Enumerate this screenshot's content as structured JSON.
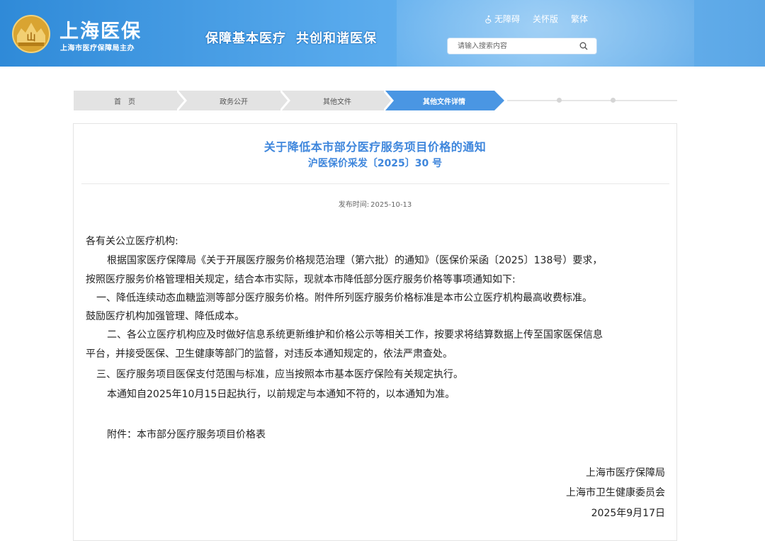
{
  "header": {
    "logo_title": "上海医保",
    "logo_subtitle": "上海市医疗保障局主办",
    "emblem_text": "山",
    "slogan_left": "保障基本医疗",
    "slogan_right": "共创和谐医保",
    "links": [
      {
        "icon": "accessibility-icon",
        "label": "无障碍"
      },
      {
        "label": "关怀版"
      },
      {
        "label": "繁体"
      }
    ],
    "search": {
      "placeholder": "请输入搜索内容",
      "icon": "search-icon"
    },
    "colors": {
      "gradient_start": "#2f8ad8",
      "gradient_end": "#6fb7f0"
    }
  },
  "breadcrumb": {
    "items": [
      {
        "label": "首　页"
      },
      {
        "label": "政务公开"
      },
      {
        "label": "其他文件"
      },
      {
        "label": "其他文件详情",
        "active": true
      }
    ],
    "colors": {
      "inactive": "#e3e3e3",
      "active": "#4a96e3"
    }
  },
  "article": {
    "title": "关于降低本市部分医疗服务项目价格的通知",
    "doc_number": "沪医保价采发〔2025〕30 号",
    "date_label": "发布时间:",
    "date_value": "2025-10-13",
    "title_color": "#3e86dc",
    "body": [
      "各有关公立医疗机构:",
      "根据国家医疗保障局《关于开展医疗服务价格规范治理（第六批）的通知》（医保价采函〔2025〕138号）要求，",
      "按照医疗服务价格管理相关规定，结合本市实际，现就本市降低部分医疗服务价格等事项通知如下:",
      "一、降低连续动态血糖监测等部分医疗服务价格。附件所列医疗服务价格标准是本市公立医疗机构最高收费标准。",
      "鼓励医疗机构加强管理、降低成本。",
      "二、各公立医疗机构应及时做好信息系统更新维护和价格公示等相关工作，按要求将结算数据上传至国家医保信息",
      "平台，并接受医保、卫生健康等部门的监督，对违反本通知规定的，依法严肃查处。",
      "三、医疗服务项目医保支付范围与标准，应当按照本市基本医疗保险有关规定执行。",
      "本通知自2025年10月15日起执行，以前规定与本通知不符的，以本通知为准。",
      "附件：本市部分医疗服务项目价格表"
    ],
    "signature": [
      "上海市医疗保障局",
      "上海市卫生健康委员会",
      "2025年9月17日"
    ]
  }
}
